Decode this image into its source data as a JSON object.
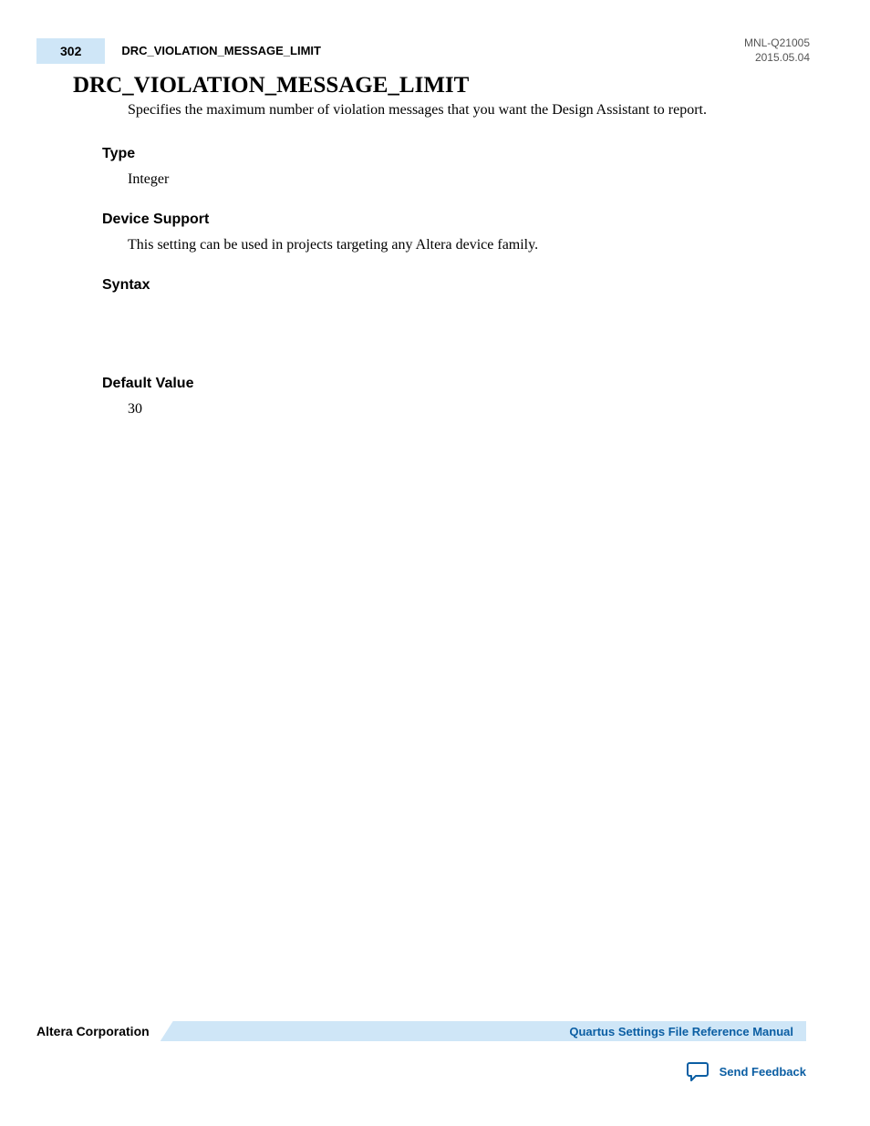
{
  "header": {
    "page_number": "302",
    "running_title": "DRC_VIOLATION_MESSAGE_LIMIT",
    "doc_id": "MNL-Q21005",
    "doc_date": "2015.05.04"
  },
  "title": "DRC_VIOLATION_MESSAGE_LIMIT",
  "intro": "Specifies the maximum number of violation messages that you want the Design Assistant to report.",
  "sections": {
    "type": {
      "heading": "Type",
      "body": "Integer"
    },
    "device_support": {
      "heading": "Device Support",
      "body": "This setting can be used in projects targeting any Altera device family."
    },
    "syntax": {
      "heading": "Syntax",
      "body": ""
    },
    "default_value": {
      "heading": "Default Value",
      "body": "30"
    }
  },
  "footer": {
    "corporation": "Altera Corporation",
    "manual_link": "Quartus Settings File Reference Manual",
    "feedback": "Send Feedback"
  }
}
